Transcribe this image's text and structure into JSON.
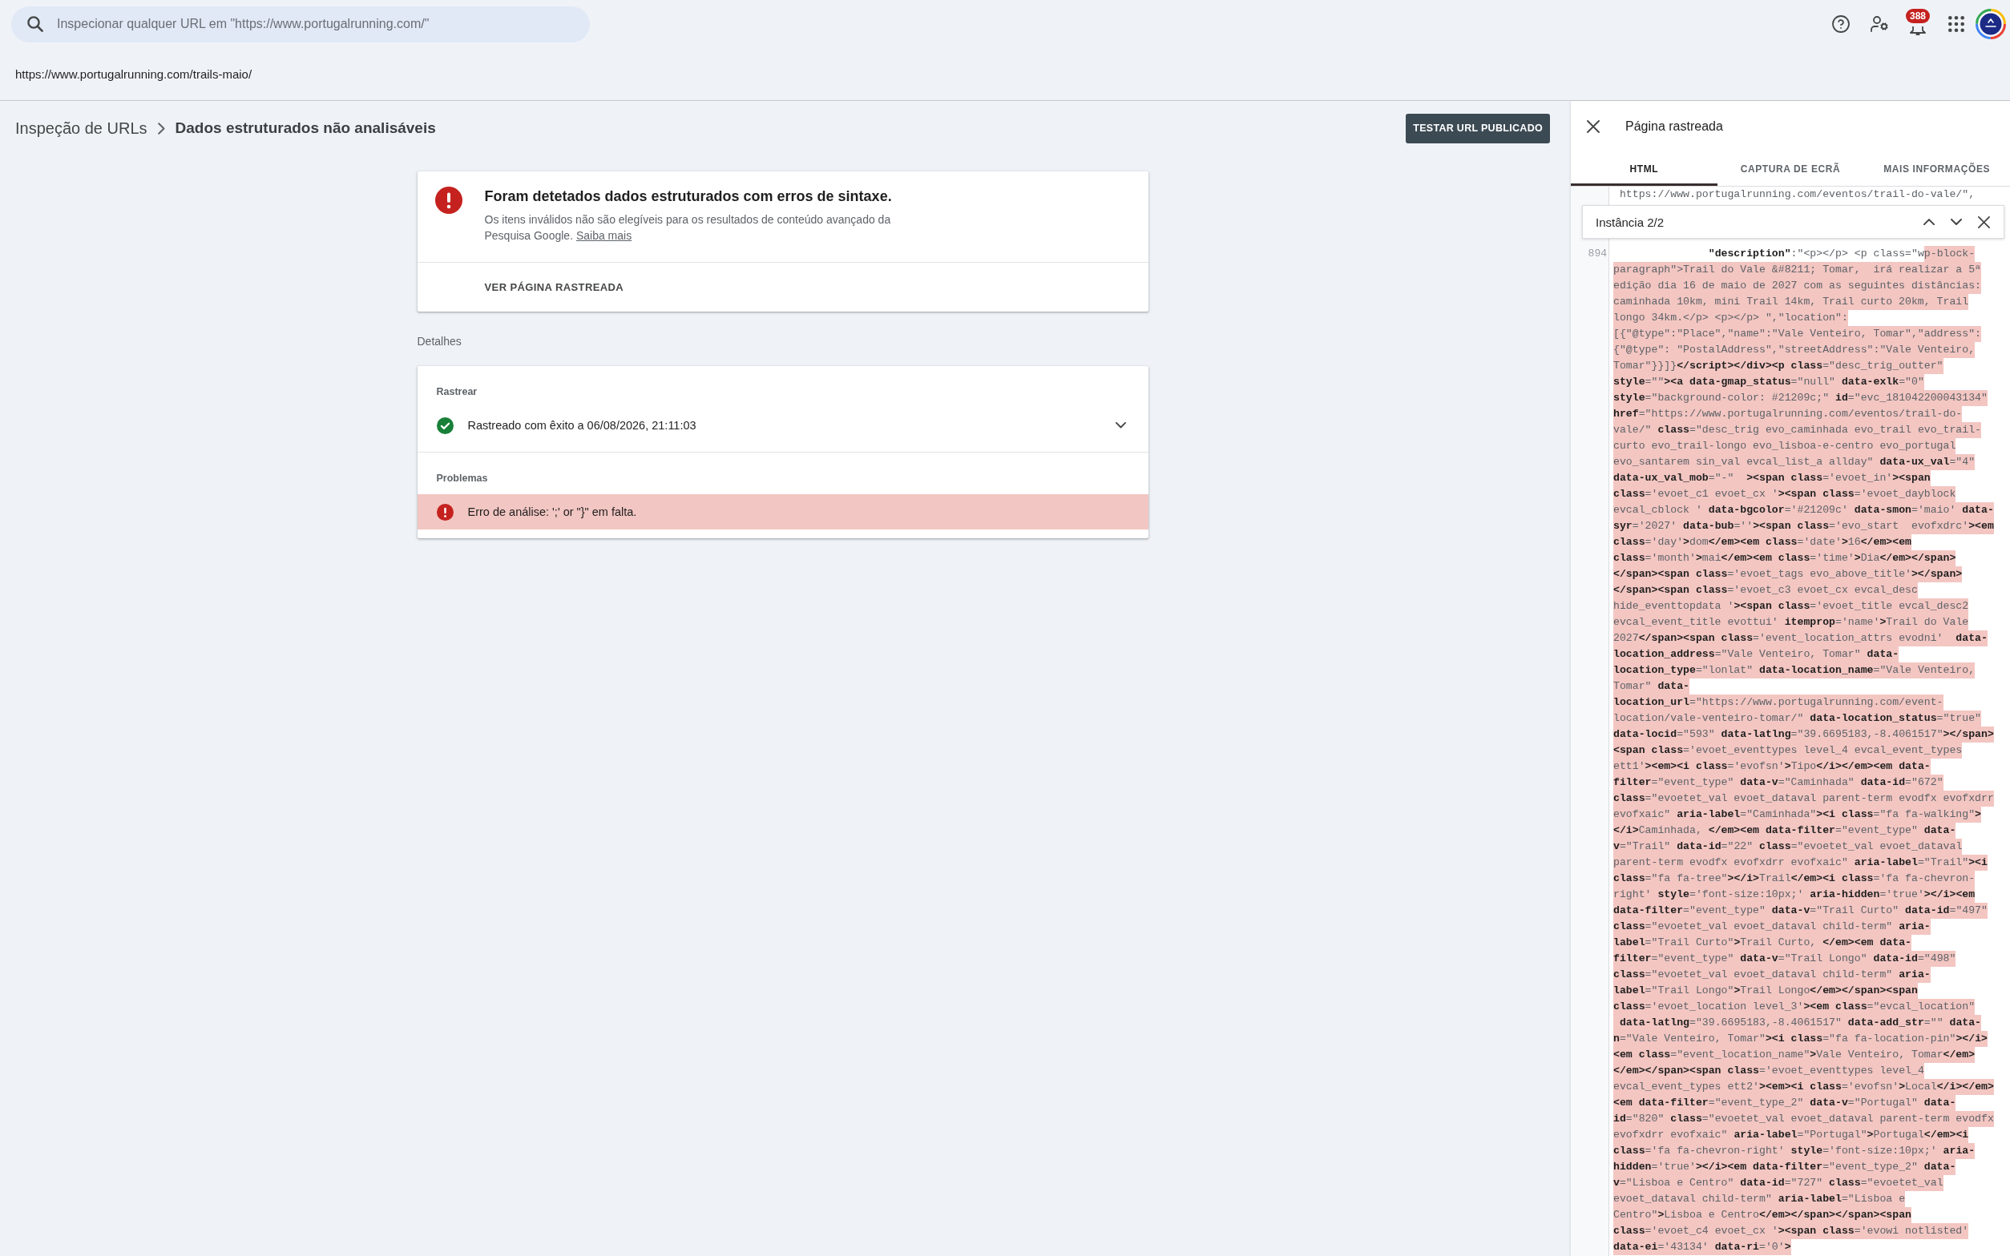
{
  "search": {
    "placeholder": "Inspecionar qualquer URL em \"https://www.portugalrunning.com/\""
  },
  "notifications": {
    "count": "388"
  },
  "inspected_url": "https://www.portugalrunning.com/trails-maio/",
  "breadcrumb": {
    "parent": "Inspeção de URLs",
    "current": "Dados estruturados não analisáveis"
  },
  "test_button": "TESTAR URL PUBLICADO",
  "summary": {
    "kind": "error",
    "title": "Foram detetados dados estruturados com erros de sintaxe.",
    "description": "Os itens inválidos não são elegíveis para os resultados de conteúdo avançado da Pesquisa Google.",
    "link": "Saiba mais",
    "action": "VER PÁGINA RASTREADA"
  },
  "details": {
    "heading": "Detalhes",
    "sections": [
      {
        "label": "Rastrear",
        "items": [
          {
            "kind": "success",
            "text": "Rastreado com êxito a 06/08/2026, 21:11:03",
            "expandable": true
          }
        ]
      },
      {
        "label": "Problemas",
        "items": [
          {
            "kind": "error",
            "text": "Erro de análise: ';' or \"}\" em falta.",
            "expandable": false
          }
        ]
      }
    ]
  },
  "panel": {
    "title": "Página rastreada",
    "tabs": [
      {
        "label": "HTML",
        "selected": true
      },
      {
        "label": "CAPTURA DE ECRÃ",
        "selected": false
      },
      {
        "label": "MAIS INFORMAÇÕES",
        "selected": false
      }
    ],
    "code_lines_above": [
      {
        "segments": [
          {
            "text": " https://www.portugalrunning.com/eventos/trail-do-vale/\",",
            "highlighted": false
          }
        ]
      }
    ],
    "find_bar": {
      "count": "Instância 2/2"
    },
    "code_lines": [
      {
        "number": "894",
        "segments": [
          {
            "text": "               **\"description\"**:\"<p></p> <p class=\"w",
            "highlighted": false
          },
          {
            "text": "p-block-",
            "highlighted": true
          }
        ]
      },
      {
        "segments": [
          {
            "text": "paragraph\">Trail do Vale &#8211; Tomar,  irá realizar a 5ª",
            "highlighted": true
          }
        ]
      },
      {
        "segments": [
          {
            "text": "edição dia 16 de maio de 2027 com as seguintes distâncias:",
            "highlighted": true
          }
        ]
      },
      {
        "segments": [
          {
            "text": "caminhada 10km, mini Trail 14km, Trail curto 20km, Trail",
            "highlighted": true
          }
        ]
      },
      {
        "segments": [
          {
            "text": "longo 34km.</p> <p></p> \",\"location\":",
            "highlighted": true
          }
        ]
      },
      {
        "segments": [
          {
            "text": "[{\"@type\":\"Place\",\"name\":\"Vale Venteiro, Tomar\",\"address\":",
            "highlighted": true
          }
        ]
      },
      {
        "segments": [
          {
            "text": "{\"@type\": \"PostalAddress\",\"streetAddress\":\"Vale Venteiro,",
            "highlighted": true
          }
        ]
      },
      {
        "segments": [
          {
            "text": "Tomar\"}}]}**</script></div><p class**=\"desc_trig_outter\"",
            "highlighted": true
          }
        ]
      },
      {
        "segments": [
          {
            "text": "**style**=\"\"**><a data-gmap_status**=\"null\" **data-exlk**=\"0\"",
            "highlighted": true
          }
        ]
      },
      {
        "segments": [
          {
            "text": "**style**=\"background-color: #21209c;\" **id**=\"evc_181042200043134\"",
            "highlighted": true
          }
        ]
      },
      {
        "segments": [
          {
            "text": "**href**=\"https://www.portugalrunning.com/eventos/trail-do-",
            "highlighted": true
          }
        ]
      },
      {
        "segments": [
          {
            "text": "vale/\" **class**=\"desc_trig evo_caminhada evo_trail evo_trail-",
            "highlighted": true
          }
        ]
      },
      {
        "segments": [
          {
            "text": "curto evo_trail-longo evo_lisboa-e-centro evo_portugal",
            "highlighted": true
          }
        ]
      },
      {
        "segments": [
          {
            "text": "evo_santarem sin_val evcal_list_a allday\" **data-ux_val**=\"4\"",
            "highlighted": true
          }
        ]
      },
      {
        "segments": [
          {
            "text": "**data-ux_val_mob**=\"-\"  **><span class**='evoet_in'**><span**",
            "highlighted": true
          }
        ]
      },
      {
        "segments": [
          {
            "text": "**class**='evoet_c1 evoet_cx '**><span class**='evoet_dayblock",
            "highlighted": true
          }
        ]
      },
      {
        "segments": [
          {
            "text": "evcal_cblock ' **data-bgcolor**='#21209c' **data-smon**='maio' **data-**",
            "highlighted": true
          }
        ]
      },
      {
        "segments": [
          {
            "text": "**syr**='2027' **data-bub**=''**><span class**='evo_start  evofxdrc'**><em**",
            "highlighted": true
          }
        ]
      },
      {
        "segments": [
          {
            "text": "**class**='day'**>**dom**</em><em class**='date'**>**16**</em><em**",
            "highlighted": true
          }
        ]
      },
      {
        "segments": [
          {
            "text": "**class**='month'**>**mai**</em><em class**='time'**>**Dia**</em></span>**",
            "highlighted": true
          }
        ]
      },
      {
        "segments": [
          {
            "text": "**</span><span class**='evoet_tags evo_above_title'**></span>**",
            "highlighted": true
          }
        ]
      },
      {
        "segments": [
          {
            "text": "**</span><span class**='evoet_c3 evoet_cx evcal_desc",
            "highlighted": true
          }
        ]
      },
      {
        "segments": [
          {
            "text": "hide_eventtopdata '**><span class**='evoet_title evcal_desc2",
            "highlighted": true
          }
        ]
      },
      {
        "segments": [
          {
            "text": "evcal_event_title evottui' **itemprop**='name'**>**Trail do Vale",
            "highlighted": true
          }
        ]
      },
      {
        "segments": [
          {
            "text": "2027**</span><span class**='event_location_attrs evodni'  **data-**",
            "highlighted": true
          }
        ]
      },
      {
        "segments": [
          {
            "text": "**location_address**=\"Vale Venteiro, Tomar\" **data-**",
            "highlighted": true
          }
        ]
      },
      {
        "segments": [
          {
            "text": "**location_type**=\"lonlat\" **data-location_name**=\"Vale Venteiro,",
            "highlighted": true
          }
        ]
      },
      {
        "segments": [
          {
            "text": "Tomar\" **data-**",
            "highlighted": true
          }
        ]
      },
      {
        "segments": [
          {
            "text": "**location_url**=\"https://www.portugalrunning.com/event-",
            "highlighted": true
          }
        ]
      },
      {
        "segments": [
          {
            "text": "location/vale-venteiro-tomar/\" **data-location_status**=\"true\"",
            "highlighted": true
          }
        ]
      },
      {
        "segments": [
          {
            "text": "**data-locid**=\"593\" **data-latlng**=\"39.6695183,-8.4061517\"**></span>**",
            "highlighted": true
          }
        ]
      },
      {
        "segments": [
          {
            "text": "**<span class**='evoet_eventtypes level_4 evcal_event_types",
            "highlighted": true
          }
        ]
      },
      {
        "segments": [
          {
            "text": "ett1'**><em><i class**='evofsn'**>**Tipo**</i></em><em data-**",
            "highlighted": true
          }
        ]
      },
      {
        "segments": [
          {
            "text": "**filter**=\"event_type\" **data-v**=\"Caminhada\" **data-id**=\"672\"",
            "highlighted": true
          }
        ]
      },
      {
        "segments": [
          {
            "text": "**class**=\"evoetet_val evoet_dataval parent-term evodfx evofxdrr",
            "highlighted": true
          }
        ]
      },
      {
        "segments": [
          {
            "text": "evofxaic\" **aria-label**=\"Caminhada\"**><i class**=\"fa fa-walking\"**>**",
            "highlighted": true
          }
        ]
      },
      {
        "segments": [
          {
            "text": "**</i>**Caminhada, **</em><em data-filter**=\"event_type\" **data-**",
            "highlighted": true
          }
        ]
      },
      {
        "segments": [
          {
            "text": "**v**=\"Trail\" **data-id**=\"22\" **class**=\"evoetet_val evoet_dataval",
            "highlighted": true
          }
        ]
      },
      {
        "segments": [
          {
            "text": "parent-term evodfx evofxdrr evofxaic\" **aria-label**=\"Trail\"**><i**",
            "highlighted": true
          }
        ]
      },
      {
        "segments": [
          {
            "text": "**class**=\"fa fa-tree\"**></i>**Trail**</em><i class**='fa fa-chevron-",
            "highlighted": true
          }
        ]
      },
      {
        "segments": [
          {
            "text": "right' **style**='font-size:10px;' **aria-hidden**='true'**></i><em**",
            "highlighted": true
          }
        ]
      },
      {
        "segments": [
          {
            "text": "**data-filter**=\"event_type\" **data-v**=\"Trail Curto\" **data-id**=\"497\"",
            "highlighted": true
          }
        ]
      },
      {
        "segments": [
          {
            "text": "**class**=\"evoetet_val evoet_dataval child-term\" **aria-**",
            "highlighted": true
          }
        ]
      },
      {
        "segments": [
          {
            "text": "**label**=\"Trail Curto\"**>**Trail Curto, **</em><em data-**",
            "highlighted": true
          }
        ]
      },
      {
        "segments": [
          {
            "text": "**filter**=\"event_type\" **data-v**=\"Trail Longo\" **data-id**=\"498\"",
            "highlighted": true
          }
        ]
      },
      {
        "segments": [
          {
            "text": "**class**=\"evoetet_val evoet_dataval child-term\" **aria-**",
            "highlighted": true
          }
        ]
      },
      {
        "segments": [
          {
            "text": "**label**=\"Trail Longo\"**>**Trail Longo**</em></span><span**",
            "highlighted": true
          }
        ]
      },
      {
        "segments": [
          {
            "text": "**class**='evoet_location level_3'**><em class**=\"evcal_location\"",
            "highlighted": true
          }
        ]
      },
      {
        "segments": [
          {
            "text": " **data-latlng**=\"39.6695183,-8.4061517\" **data-add_str**=\"\" **data-**",
            "highlighted": true
          }
        ]
      },
      {
        "segments": [
          {
            "text": "**n**=\"Vale Venteiro, Tomar\"**><i class**=\"fa fa-location-pin\"**></i>**",
            "highlighted": true
          }
        ]
      },
      {
        "segments": [
          {
            "text": "**<em class**=\"event_location_name\"**>**Vale Venteiro, Tomar**</em>**",
            "highlighted": true
          }
        ]
      },
      {
        "segments": [
          {
            "text": "**</em></span><span class**='evoet_eventtypes level_4",
            "highlighted": true
          }
        ]
      },
      {
        "segments": [
          {
            "text": "evcal_event_types ett2'**><em><i class**='evofsn'**>**Local**</i></em>**",
            "highlighted": true
          }
        ]
      },
      {
        "segments": [
          {
            "text": "**<em data-filter**=\"event_type_2\" **data-v**=\"Portugal\" **data-**",
            "highlighted": true
          }
        ]
      },
      {
        "segments": [
          {
            "text": "**id**=\"820\" **class**=\"evoetet_val evoet_dataval parent-term evodfx",
            "highlighted": true
          }
        ]
      },
      {
        "segments": [
          {
            "text": "evofxdrr evofxaic\" **aria-label**=\"Portugal\"**>**Portugal**</em><i**",
            "highlighted": true
          }
        ]
      },
      {
        "segments": [
          {
            "text": "**class**='fa fa-chevron-right' **style**='font-size:10px;' **aria-**",
            "highlighted": true
          }
        ]
      },
      {
        "segments": [
          {
            "text": "**hidden**='true'**></i><em data-filter**=\"event_type_2\" **data-**",
            "highlighted": true
          }
        ]
      },
      {
        "segments": [
          {
            "text": "**v**=\"Lisboa e Centro\" **data-id**=\"727\" **class**=\"evoetet_val",
            "highlighted": true
          }
        ]
      },
      {
        "segments": [
          {
            "text": "evoet_dataval child-term\" **aria-label**=\"Lisboa e",
            "highlighted": true
          }
        ]
      },
      {
        "segments": [
          {
            "text": "Centro\"**>**Lisboa e Centro**</em></span></span><span**",
            "highlighted": true
          }
        ]
      },
      {
        "segments": [
          {
            "text": "**class**='evoet_c4 evoet_cx '**><span class**='evowi notlisted'",
            "highlighted": true
          }
        ]
      },
      {
        "segments": [
          {
            "text": "**data-ei**='43134' **data-ri**='0'**>**",
            "highlighted": true
          }
        ]
      }
    ]
  }
}
